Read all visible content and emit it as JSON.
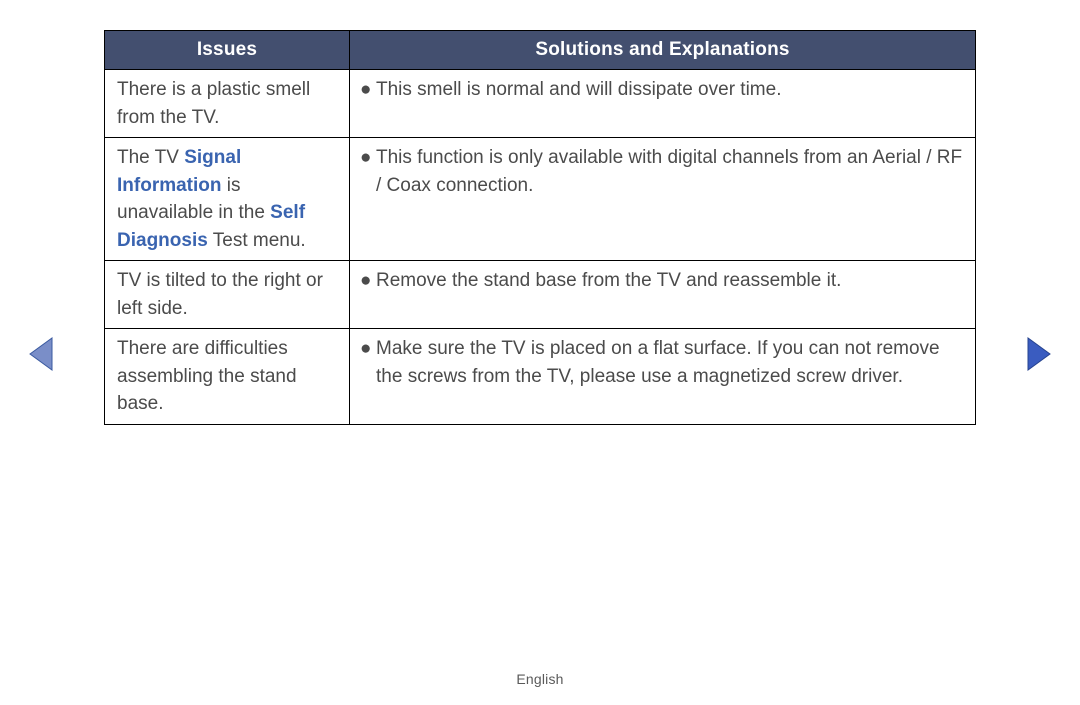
{
  "headers": {
    "issues": "Issues",
    "solutions": "Solutions and Explanations"
  },
  "rows": [
    {
      "issue": {
        "segments": [
          {
            "t": "There is a plastic smell from the TV."
          }
        ]
      },
      "solution": "This smell is normal and will dissipate over time."
    },
    {
      "issue": {
        "segments": [
          {
            "t": "The TV "
          },
          {
            "t": "Signal Information",
            "hl": true
          },
          {
            "t": " is unavailable in the "
          },
          {
            "t": "Self Diagnosis",
            "hl": true
          },
          {
            "t": " Test menu."
          }
        ]
      },
      "solution": "This function is only available with digital channels from an Aerial / RF / Coax connection."
    },
    {
      "issue": {
        "segments": [
          {
            "t": "TV is tilted to the right or left side."
          }
        ]
      },
      "solution": "Remove the stand base from the TV and reassemble it."
    },
    {
      "issue": {
        "segments": [
          {
            "t": "There are difficulties assembling the stand base."
          }
        ]
      },
      "solution": "Make sure the TV is placed on a flat surface. If you can not remove the screws from the TV, please use a magnetized screw driver."
    }
  ],
  "footer": {
    "language": "English"
  },
  "colors": {
    "header_bg": "#434f6f",
    "accent": "#3a64b0"
  },
  "nav": {
    "left_label": "Previous page",
    "right_label": "Next page"
  }
}
